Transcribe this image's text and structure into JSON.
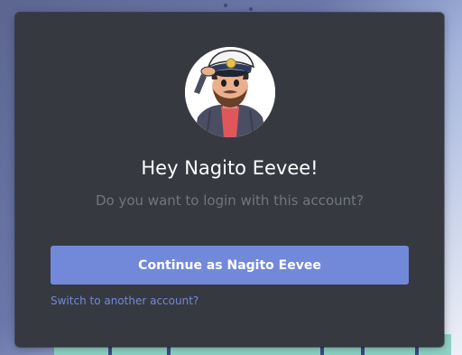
{
  "modal": {
    "title": "Hey Nagito Eevee!",
    "subtitle": "Do you want to login with this account?",
    "continue_label": "Continue as Nagito Eevee",
    "switch_label": "Switch to another account?",
    "avatar_icon": "user-avatar"
  },
  "colors": {
    "modal_bg": "#36393f",
    "accent": "#7289da",
    "title": "#ffffff",
    "subtitle": "#72767d"
  }
}
